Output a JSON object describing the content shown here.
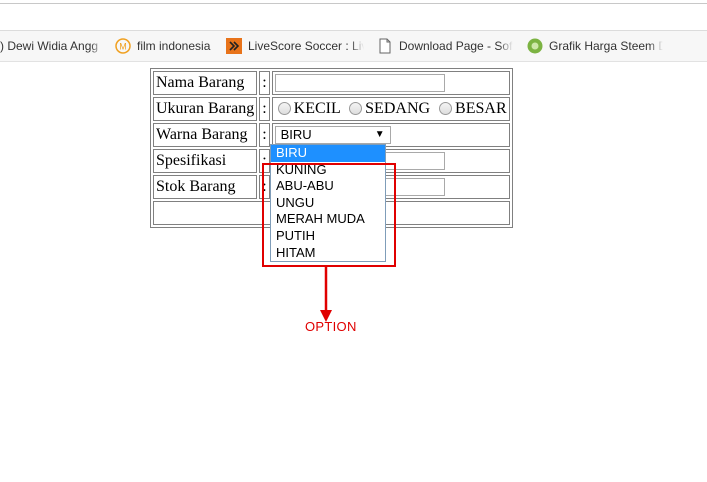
{
  "bookmarks": [
    {
      "label": ") Dewi Widia Angg",
      "icon": "none"
    },
    {
      "label": "film indonesia",
      "icon": "m-circle-icon"
    },
    {
      "label": "LiveScore Soccer : Liv",
      "icon": "livescore-icon"
    },
    {
      "label": "Download Page - Sof",
      "icon": "page-icon"
    },
    {
      "label": "Grafik Harga Steem D",
      "icon": "steem-icon"
    }
  ],
  "form": {
    "rows": [
      {
        "label": "Nama Barang",
        "colon": ":"
      },
      {
        "label": "Ukuran Barang",
        "colon": ":"
      },
      {
        "label": "Warna Barang",
        "colon": ":"
      },
      {
        "label": "Spesifikasi",
        "colon": ":"
      },
      {
        "label": "Stok Barang",
        "colon": ":"
      }
    ],
    "radio_options": [
      "KECIL",
      "SEDANG",
      "BESAR"
    ],
    "color_select": {
      "value": "BIRU",
      "options": [
        "BIRU",
        "KUNING",
        "ABU-ABU",
        "UNGU",
        "MERAH MUDA",
        "PUTIH",
        "HITAM"
      ]
    }
  },
  "annotation": {
    "text": "OPTION",
    "color": "#e00000"
  }
}
